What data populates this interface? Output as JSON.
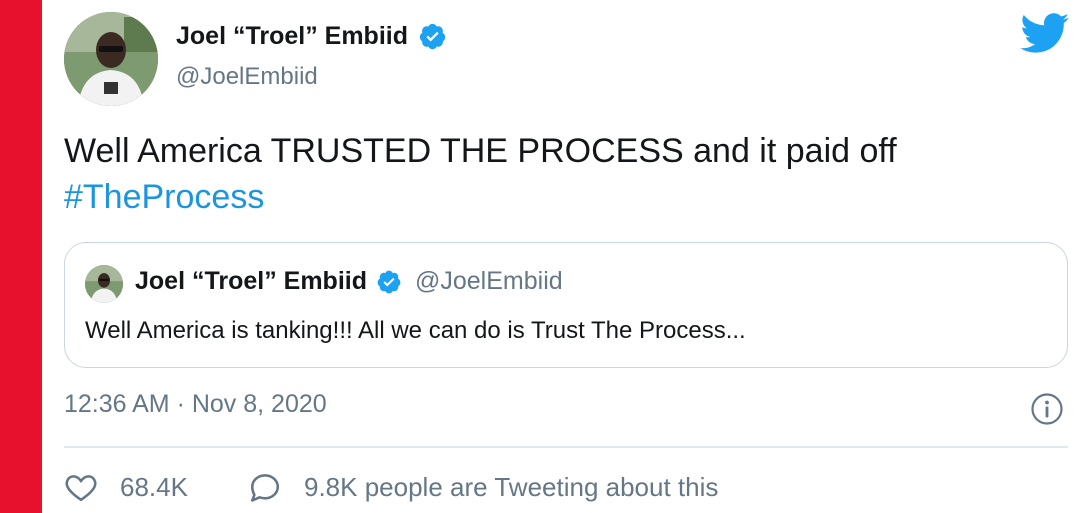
{
  "author": {
    "display_name": "Joel “Troel” Embiid",
    "handle": "@JoelEmbiid"
  },
  "tweet": {
    "text": "Well America TRUSTED THE PROCESS and it paid off",
    "hashtag": "#TheProcess"
  },
  "quoted_tweet": {
    "display_name": "Joel “Troel” Embiid",
    "handle": "@JoelEmbiid",
    "text": "Well America is tanking!!! All we can do is Trust The Process..."
  },
  "meta": {
    "timestamp": "12:36 AM · Nov 8, 2020"
  },
  "stats": {
    "likes": "68.4K",
    "conversation": "9.8K people are Tweeting about this"
  },
  "colors": {
    "accent": "#1b95e0",
    "side_bar": "#e8112d",
    "muted": "#657786"
  },
  "icons": [
    "twitter-bird-icon",
    "verified-badge-icon",
    "info-icon",
    "heart-icon",
    "speech-bubble-icon"
  ]
}
